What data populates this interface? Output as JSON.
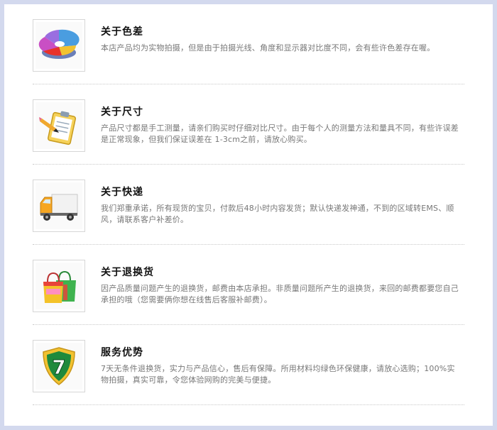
{
  "items": [
    {
      "icon": "color-wheel-icon",
      "title": "关于色差",
      "desc": "本店产品均为实物拍摄，但是由于拍摄光线、角度和显示器对比度不同，会有些许色差存在喔。"
    },
    {
      "icon": "clipboard-pencil-icon",
      "title": "关于尺寸",
      "desc": "产品尺寸都是手工测量，请亲们购买时仔细对比尺寸。由于每个人的测量方法和量具不同，有些许误差是正常现象，但我们保证误差在 1-3cm之前，请放心购买。"
    },
    {
      "icon": "delivery-truck-icon",
      "title": "关于快递",
      "desc": "我们郑重承诺，所有现货的宝贝，付款后48小时内容发货；默认快递发神通，不到的区域转EMS、顺风，请联系客户补差价。"
    },
    {
      "icon": "shopping-bags-icon",
      "title": "关于退换货",
      "desc": "因产品质量问题产生的退换货，邮费由本店承担。非质量问题所产生的退换货，来回的邮费都要您自己承担的哦（您需要俩你想在线售后客服补邮费）。"
    },
    {
      "icon": "seven-day-shield-icon",
      "badge": "7",
      "title": "服务优势",
      "desc": "7天无条件退换货，实力与产品信心，售后有保障。所用材料均绿色环保健康，请放心选购；100%实物拍摄，真实可靠，令您体验网购的完美与便捷。"
    }
  ]
}
